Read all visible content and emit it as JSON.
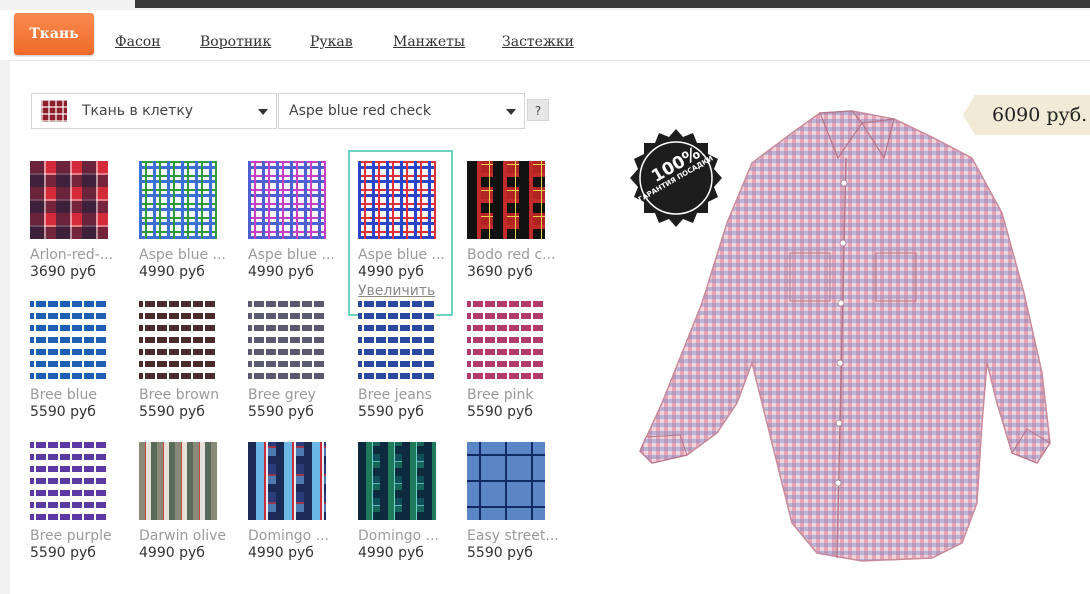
{
  "tabs": [
    {
      "label": "Ткань",
      "active": true
    },
    {
      "label": "Фасон"
    },
    {
      "label": "Воротник"
    },
    {
      "label": "Рукав"
    },
    {
      "label": "Манжеты"
    },
    {
      "label": "Застежки"
    }
  ],
  "filters": {
    "category": "Ткань в клетку",
    "fabric": "Aspe blue red check",
    "help": "?"
  },
  "fabrics": [
    {
      "name": "Arlon-red-...",
      "price": "3690 руб",
      "pattern": "p-red"
    },
    {
      "name": "Aspe blue ...",
      "price": "4990 руб",
      "pattern": "p-aspe1"
    },
    {
      "name": "Aspe blue ...",
      "price": "4990 руб",
      "pattern": "p-aspe2"
    },
    {
      "name": "Aspe blue ...",
      "price": "4990 руб",
      "pattern": "p-aspe3",
      "selected": true,
      "action": "Увеличить"
    },
    {
      "name": "Bodo red c...",
      "price": "3690 руб",
      "pattern": "p-bodo"
    },
    {
      "name": "Bree blue",
      "price": "5590 руб",
      "pattern": "p-bree",
      "color": "#1e5fb5"
    },
    {
      "name": "Bree brown",
      "price": "5590 руб",
      "pattern": "p-bree",
      "color": "#4a2a2a"
    },
    {
      "name": "Bree grey",
      "price": "5590 руб",
      "pattern": "p-bree",
      "color": "#5c5a70"
    },
    {
      "name": "Bree jeans",
      "price": "5590 руб",
      "pattern": "p-bree",
      "color": "#2a4aa0"
    },
    {
      "name": "Bree pink",
      "price": "5590 руб",
      "pattern": "p-bree",
      "color": "#b23a6a"
    },
    {
      "name": "Bree purple",
      "price": "5590 руб",
      "pattern": "p-bree",
      "color": "#5a3aa0"
    },
    {
      "name": "Darwin olive",
      "price": "4990 руб",
      "pattern": "p-darwin"
    },
    {
      "name": "Domingo ...",
      "price": "4990 руб",
      "pattern": "p-domingo1"
    },
    {
      "name": "Domingo ...",
      "price": "4990 руб",
      "pattern": "p-domingo2"
    },
    {
      "name": "Easy street...",
      "price": "5590 руб",
      "pattern": "p-easy"
    }
  ],
  "preview": {
    "price": "6090 руб.",
    "badge_big": "100%",
    "badge_small": "ГАРАНТИЯ ПОСАДКИ"
  },
  "colors": {
    "accent": "#ef6a2a",
    "selected_border": "#69d5c1"
  }
}
